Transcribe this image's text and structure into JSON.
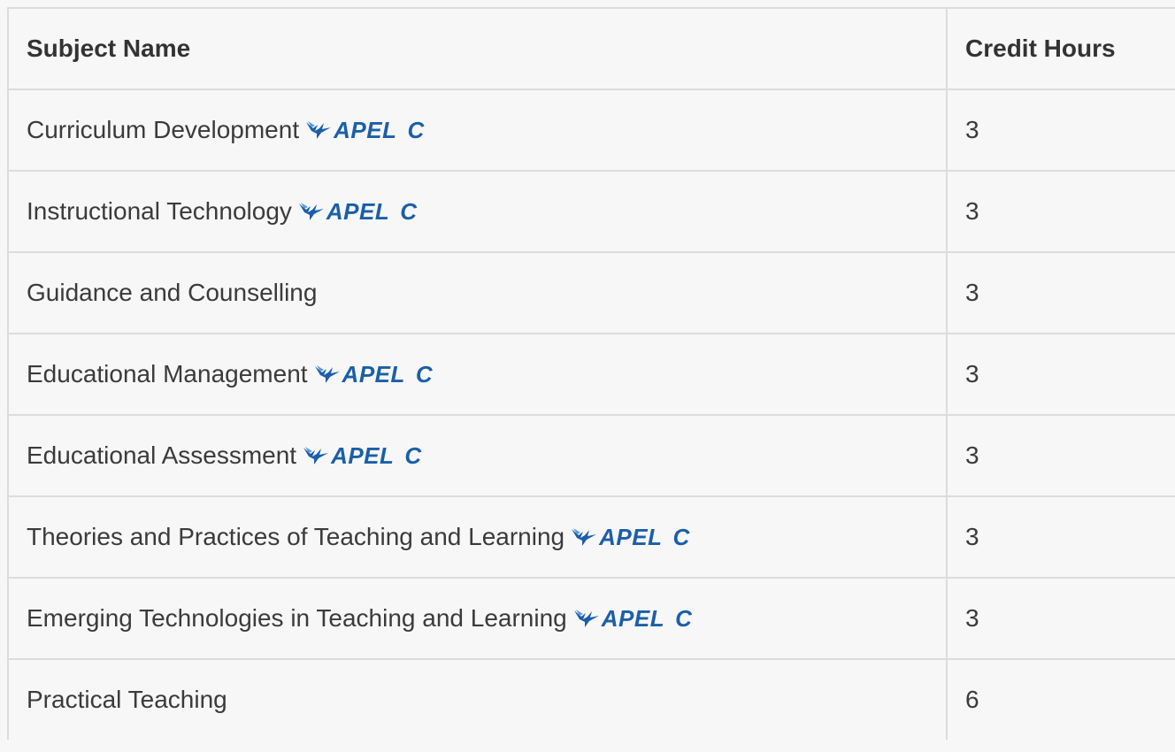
{
  "table": {
    "headers": {
      "subject": "Subject Name",
      "credits": "Credit Hours"
    },
    "rows": [
      {
        "subject": "Curriculum Development",
        "apel": true,
        "credits": "3"
      },
      {
        "subject": "Instructional Technology",
        "apel": true,
        "credits": "3"
      },
      {
        "subject": "Guidance and Counselling",
        "apel": false,
        "credits": "3"
      },
      {
        "subject": "Educational Management",
        "apel": true,
        "credits": "3"
      },
      {
        "subject": "Educational Assessment",
        "apel": true,
        "credits": "3"
      },
      {
        "subject": "Theories and Practices of Teaching and Learning",
        "apel": true,
        "credits": "3"
      },
      {
        "subject": "Emerging Technologies in Teaching and Learning",
        "apel": true,
        "credits": "3"
      },
      {
        "subject": "Practical Teaching",
        "apel": false,
        "credits": "6"
      }
    ]
  },
  "badge": {
    "text": "APEL",
    "suffix": "C",
    "icon": "bird-logo-icon",
    "color": "#1b5fa8"
  }
}
